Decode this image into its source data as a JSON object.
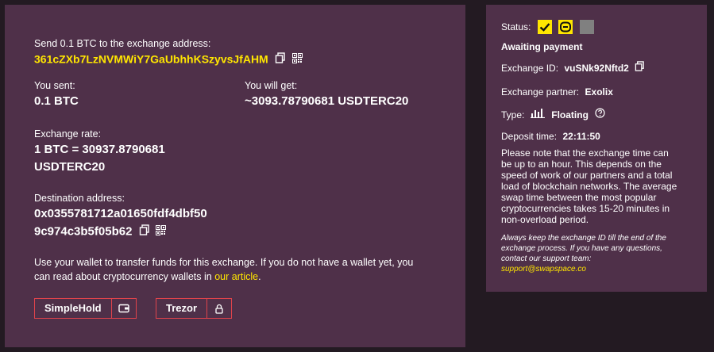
{
  "main": {
    "send_label": "Send 0.1 BTC to the exchange address:",
    "deposit_address": "361cZXb7LzNVMWiY7GaUbhhKSzyvsJfAHM",
    "you_sent_label": "You sent:",
    "you_sent_value": "0.1 BTC",
    "you_get_label": "You will get:",
    "you_get_value": "~3093.78790681 USDTERC20",
    "rate_label": "Exchange rate:",
    "rate_value_line1": "1 BTC = 30937.8790681",
    "rate_value_line2": "USDTERC20",
    "dest_label": "Destination address:",
    "dest_line1": "0x0355781712a01650fdf4dbf50",
    "dest_line2": "9c974c3b5f05b62",
    "wallet_text_1": "Use your wallet to transfer funds for this exchange. If you do not have a wallet yet, you",
    "wallet_text_2": "can read about cryptocurrency wallets in",
    "wallet_link": "our article",
    "wallet_text_end": ".",
    "wallets": [
      {
        "name": "SimpleHold",
        "icon": "wallet-icon"
      },
      {
        "name": "Trezor",
        "icon": "lock-icon"
      }
    ]
  },
  "side": {
    "status_label": "Status:",
    "status_text": "Awaiting payment",
    "exchange_id_label": "Exchange ID:",
    "exchange_id": "vuSNk92Nftd2",
    "partner_label": "Exchange partner:",
    "partner": "Exolix",
    "type_label": "Type:",
    "type_value": "Floating",
    "deposit_time_label": "Deposit time:",
    "deposit_time": "22:11:50",
    "note_lines": [
      "Please note that the exchange time can",
      "be up to an hour. This depends on the",
      "speed of work of our partners and a total",
      "load of blockchain networks. The average",
      "swap time between the most popular",
      "cryptocurrencies takes 15-20 minutes in",
      "non-overload period."
    ],
    "italic_lines": [
      "Always keep the exchange ID till the end of the",
      "exchange process. If you have any questions,",
      "contact our support team:"
    ],
    "support_email": "support@swapspace.co"
  },
  "colors": {
    "accent": "#ffe600",
    "panel": "#4f3049",
    "background": "#231a22",
    "button_border": "#e0434b"
  }
}
